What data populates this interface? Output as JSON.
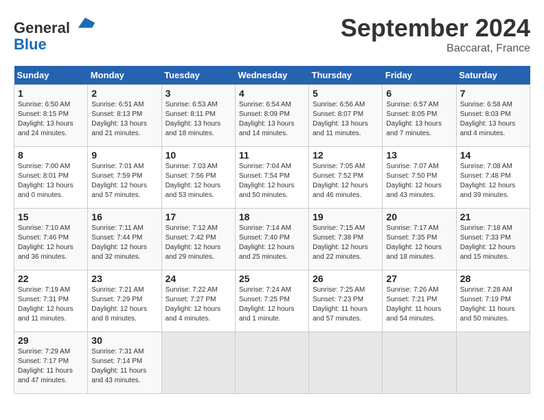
{
  "header": {
    "logo_general": "General",
    "logo_blue": "Blue",
    "month_title": "September 2024",
    "location": "Baccarat, France"
  },
  "calendar": {
    "days_of_week": [
      "Sunday",
      "Monday",
      "Tuesday",
      "Wednesday",
      "Thursday",
      "Friday",
      "Saturday"
    ],
    "weeks": [
      [
        null,
        null,
        null,
        null,
        null,
        null,
        null
      ]
    ],
    "cells": [
      {
        "day": null
      },
      {
        "day": null
      },
      {
        "day": null
      },
      {
        "day": null
      },
      {
        "day": null
      },
      {
        "day": null
      },
      {
        "day": null
      }
    ],
    "rows": [
      [
        {
          "day": null,
          "empty": true
        },
        {
          "day": null,
          "empty": true
        },
        {
          "day": null,
          "empty": true
        },
        {
          "day": null,
          "empty": true
        },
        {
          "day": null,
          "empty": true
        },
        {
          "day": null,
          "empty": true
        },
        {
          "day": null,
          "empty": true
        }
      ]
    ]
  },
  "days": [
    {
      "num": null,
      "sunrise": null,
      "sunset": null,
      "daylight": null
    },
    {
      "num": null,
      "sunrise": null,
      "sunset": null,
      "daylight": null
    }
  ],
  "week1": [
    {
      "num": "",
      "sunrise": "",
      "sunset": "",
      "daylight": "",
      "empty": true
    },
    {
      "num": "",
      "sunrise": "",
      "sunset": "",
      "daylight": "",
      "empty": true
    },
    {
      "num": "",
      "sunrise": "",
      "sunset": "",
      "daylight": "",
      "empty": true
    },
    {
      "num": "",
      "sunrise": "",
      "sunset": "",
      "daylight": "",
      "empty": true
    },
    {
      "num": "5",
      "sunrise": "Sunrise: 6:56 AM",
      "sunset": "Sunset: 8:07 PM",
      "daylight": "Daylight: 13 hours and 11 minutes."
    },
    {
      "num": "6",
      "sunrise": "Sunrise: 6:57 AM",
      "sunset": "Sunset: 8:05 PM",
      "daylight": "Daylight: 13 hours and 7 minutes."
    },
    {
      "num": "7",
      "sunrise": "Sunrise: 6:58 AM",
      "sunset": "Sunset: 8:03 PM",
      "daylight": "Daylight: 13 hours and 4 minutes."
    }
  ],
  "week1_sun": {
    "num": "1",
    "sunrise": "Sunrise: 6:50 AM",
    "sunset": "Sunset: 8:15 PM",
    "daylight": "Daylight: 13 hours and 24 minutes."
  },
  "week1_mon": {
    "num": "2",
    "sunrise": "Sunrise: 6:51 AM",
    "sunset": "Sunset: 8:13 PM",
    "daylight": "Daylight: 13 hours and 21 minutes."
  },
  "week1_tue": {
    "num": "3",
    "sunrise": "Sunrise: 6:53 AM",
    "sunset": "Sunset: 8:11 PM",
    "daylight": "Daylight: 13 hours and 18 minutes."
  },
  "week1_wed": {
    "num": "4",
    "sunrise": "Sunrise: 6:54 AM",
    "sunset": "Sunset: 8:09 PM",
    "daylight": "Daylight: 13 hours and 14 minutes."
  },
  "week1_thu": {
    "num": "5",
    "sunrise": "Sunrise: 6:56 AM",
    "sunset": "Sunset: 8:07 PM",
    "daylight": "Daylight: 13 hours and 11 minutes."
  },
  "week1_fri": {
    "num": "6",
    "sunrise": "Sunrise: 6:57 AM",
    "sunset": "Sunset: 8:05 PM",
    "daylight": "Daylight: 13 hours and 7 minutes."
  },
  "week1_sat": {
    "num": "7",
    "sunrise": "Sunrise: 6:58 AM",
    "sunset": "Sunset: 8:03 PM",
    "daylight": "Daylight: 13 hours and 4 minutes."
  },
  "week2_sun": {
    "num": "8",
    "sunrise": "Sunrise: 7:00 AM",
    "sunset": "Sunset: 8:01 PM",
    "daylight": "Daylight: 13 hours and 0 minutes."
  },
  "week2_mon": {
    "num": "9",
    "sunrise": "Sunrise: 7:01 AM",
    "sunset": "Sunset: 7:59 PM",
    "daylight": "Daylight: 12 hours and 57 minutes."
  },
  "week2_tue": {
    "num": "10",
    "sunrise": "Sunrise: 7:03 AM",
    "sunset": "Sunset: 7:56 PM",
    "daylight": "Daylight: 12 hours and 53 minutes."
  },
  "week2_wed": {
    "num": "11",
    "sunrise": "Sunrise: 7:04 AM",
    "sunset": "Sunset: 7:54 PM",
    "daylight": "Daylight: 12 hours and 50 minutes."
  },
  "week2_thu": {
    "num": "12",
    "sunrise": "Sunrise: 7:05 AM",
    "sunset": "Sunset: 7:52 PM",
    "daylight": "Daylight: 12 hours and 46 minutes."
  },
  "week2_fri": {
    "num": "13",
    "sunrise": "Sunrise: 7:07 AM",
    "sunset": "Sunset: 7:50 PM",
    "daylight": "Daylight: 12 hours and 43 minutes."
  },
  "week2_sat": {
    "num": "14",
    "sunrise": "Sunrise: 7:08 AM",
    "sunset": "Sunset: 7:48 PM",
    "daylight": "Daylight: 12 hours and 39 minutes."
  },
  "week3_sun": {
    "num": "15",
    "sunrise": "Sunrise: 7:10 AM",
    "sunset": "Sunset: 7:46 PM",
    "daylight": "Daylight: 12 hours and 36 minutes."
  },
  "week3_mon": {
    "num": "16",
    "sunrise": "Sunrise: 7:11 AM",
    "sunset": "Sunset: 7:44 PM",
    "daylight": "Daylight: 12 hours and 32 minutes."
  },
  "week3_tue": {
    "num": "17",
    "sunrise": "Sunrise: 7:12 AM",
    "sunset": "Sunset: 7:42 PM",
    "daylight": "Daylight: 12 hours and 29 minutes."
  },
  "week3_wed": {
    "num": "18",
    "sunrise": "Sunrise: 7:14 AM",
    "sunset": "Sunset: 7:40 PM",
    "daylight": "Daylight: 12 hours and 25 minutes."
  },
  "week3_thu": {
    "num": "19",
    "sunrise": "Sunrise: 7:15 AM",
    "sunset": "Sunset: 7:38 PM",
    "daylight": "Daylight: 12 hours and 22 minutes."
  },
  "week3_fri": {
    "num": "20",
    "sunrise": "Sunrise: 7:17 AM",
    "sunset": "Sunset: 7:35 PM",
    "daylight": "Daylight: 12 hours and 18 minutes."
  },
  "week3_sat": {
    "num": "21",
    "sunrise": "Sunrise: 7:18 AM",
    "sunset": "Sunset: 7:33 PM",
    "daylight": "Daylight: 12 hours and 15 minutes."
  },
  "week4_sun": {
    "num": "22",
    "sunrise": "Sunrise: 7:19 AM",
    "sunset": "Sunset: 7:31 PM",
    "daylight": "Daylight: 12 hours and 11 minutes."
  },
  "week4_mon": {
    "num": "23",
    "sunrise": "Sunrise: 7:21 AM",
    "sunset": "Sunset: 7:29 PM",
    "daylight": "Daylight: 12 hours and 8 minutes."
  },
  "week4_tue": {
    "num": "24",
    "sunrise": "Sunrise: 7:22 AM",
    "sunset": "Sunset: 7:27 PM",
    "daylight": "Daylight: 12 hours and 4 minutes."
  },
  "week4_wed": {
    "num": "25",
    "sunrise": "Sunrise: 7:24 AM",
    "sunset": "Sunset: 7:25 PM",
    "daylight": "Daylight: 12 hours and 1 minute."
  },
  "week4_thu": {
    "num": "26",
    "sunrise": "Sunrise: 7:25 AM",
    "sunset": "Sunset: 7:23 PM",
    "daylight": "Daylight: 11 hours and 57 minutes."
  },
  "week4_fri": {
    "num": "27",
    "sunrise": "Sunrise: 7:26 AM",
    "sunset": "Sunset: 7:21 PM",
    "daylight": "Daylight: 11 hours and 54 minutes."
  },
  "week4_sat": {
    "num": "28",
    "sunrise": "Sunrise: 7:28 AM",
    "sunset": "Sunset: 7:19 PM",
    "daylight": "Daylight: 11 hours and 50 minutes."
  },
  "week5_sun": {
    "num": "29",
    "sunrise": "Sunrise: 7:29 AM",
    "sunset": "Sunset: 7:17 PM",
    "daylight": "Daylight: 11 hours and 47 minutes."
  },
  "week5_mon": {
    "num": "30",
    "sunrise": "Sunrise: 7:31 AM",
    "sunset": "Sunset: 7:14 PM",
    "daylight": "Daylight: 11 hours and 43 minutes."
  },
  "col_headers": [
    "Sunday",
    "Monday",
    "Tuesday",
    "Wednesday",
    "Thursday",
    "Friday",
    "Saturday"
  ]
}
